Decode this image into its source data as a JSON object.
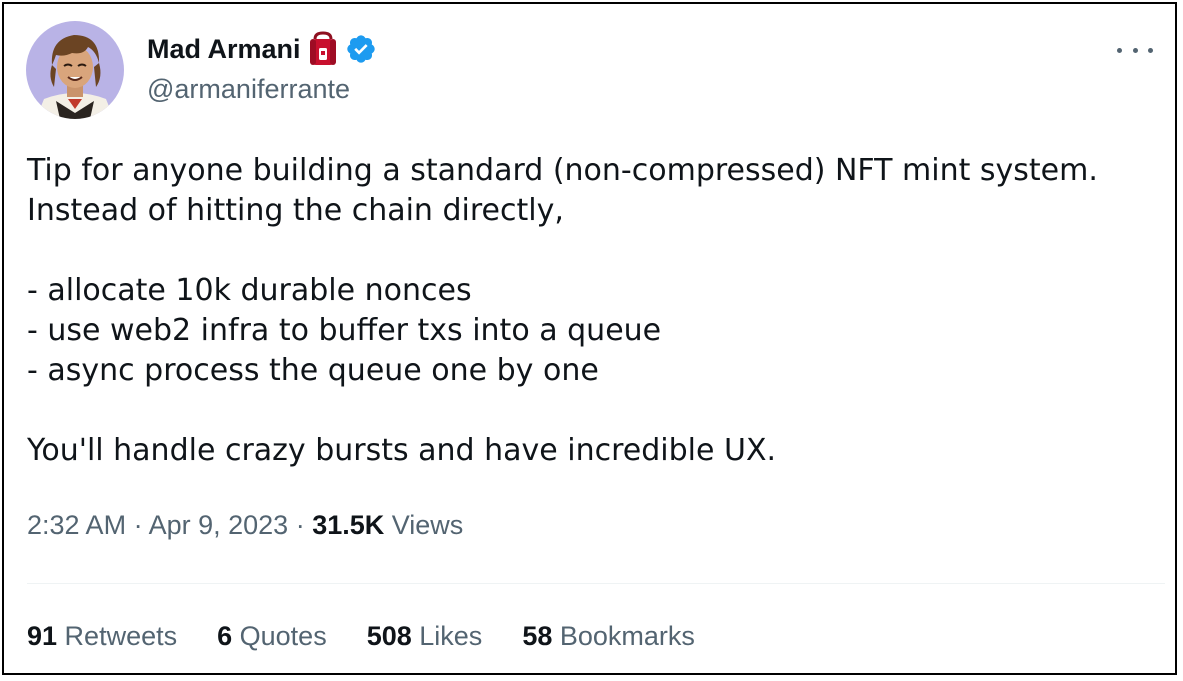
{
  "tweet": {
    "author": {
      "display_name": "Mad Armani",
      "handle": "@armaniferrante",
      "name_emoji": "backpack-emoji",
      "verified_icon": "verified-badge-icon",
      "avatar": "anime-avatar"
    },
    "menu_icon": "more-options-icon",
    "body": {
      "line1": "Tip for anyone building a standard (non-compressed) NFT mint system.",
      "line2": "Instead of hitting the chain directly,",
      "bullet1": "- allocate 10k durable nonces",
      "bullet2": "- use web2 infra to buffer txs into a queue",
      "bullet3": "- async process the queue one by one",
      "closing": "You'll handle crazy bursts and have incredible UX."
    },
    "meta": {
      "time": "2:32 AM",
      "separator1": " · ",
      "date": "Apr 9, 2023",
      "separator2": " · ",
      "views_count": "31.5K",
      "views_label": " Views"
    },
    "stats": {
      "retweets_count": "91",
      "retweets_label": " Retweets",
      "quotes_count": "6",
      "quotes_label": " Quotes",
      "likes_count": "508",
      "likes_label": " Likes",
      "bookmarks_count": "58",
      "bookmarks_label": " Bookmarks"
    }
  },
  "colors": {
    "text_primary": "#0f1419",
    "text_secondary": "#536471",
    "verified_blue": "#1d9bf0",
    "divider": "#eff3f4",
    "emoji_red": "#c8102e"
  }
}
